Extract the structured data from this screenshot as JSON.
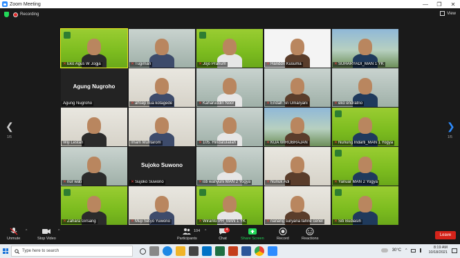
{
  "window": {
    "title": "Zoom Meeting",
    "controls": [
      "—",
      "❐",
      "✕"
    ]
  },
  "topbar": {
    "recording_label": "Recording",
    "view_label": "View"
  },
  "pager": {
    "left": "1/5",
    "right": "1/5"
  },
  "participants": [
    {
      "name": "Eko Agus W Jogja",
      "muted": true,
      "active": true
    },
    {
      "name": "Tugiman",
      "muted": true
    },
    {
      "name": "Jojo Prahum",
      "muted": true
    },
    {
      "name": "Handdri Kusuma",
      "muted": true
    },
    {
      "name": "SUHARYADI_MAN 1 YK",
      "muted": true
    },
    {
      "name": "Agung Nugroho",
      "muted": false,
      "big_name": "Agung Nugroho"
    },
    {
      "name": "ahsep kua kotagede",
      "muted": true
    },
    {
      "name": "Kaharuddin Noor",
      "muted": true
    },
    {
      "name": "Endah Sri Umaryani",
      "muted": true
    },
    {
      "name": "eko endratno",
      "muted": true
    },
    {
      "name": "Wiji Lestari",
      "muted": false
    },
    {
      "name": "Imam Muhtarom",
      "muted": false
    },
    {
      "name": "105. Hindatulailah",
      "muted": true
    },
    {
      "name": "KUA WIROBRAJAN",
      "muted": true
    },
    {
      "name": "Nunung Indarti_MAN 1 Yogya",
      "muted": true
    },
    {
      "name": "nur wati",
      "muted": true
    },
    {
      "name": "Sujoko Suwono",
      "muted": true,
      "big_name": "Sujoko Suwono"
    },
    {
      "name": "isti wahyuni MAN 2 Yogya",
      "muted": true
    },
    {
      "name": "Nunuk Adi",
      "muted": true
    },
    {
      "name": "Yanuar MAN 2 Yogya",
      "muted": true
    },
    {
      "name": "Zahara Girsang",
      "muted": true
    },
    {
      "name": "Muji Setyo Yuwono",
      "muted": true
    },
    {
      "name": "Wiranto PH_MAN 1 YK",
      "muted": true
    },
    {
      "name": "nanang suryana fahrie cenel",
      "muted": true
    },
    {
      "name": "Siti Budiasih",
      "muted": true
    }
  ],
  "toolbar": {
    "unmute": "Unmute",
    "stop_video": "Stop Video",
    "participants": "Participants",
    "participants_count": "104",
    "chat": "Chat",
    "chat_badge": "4",
    "share_screen": "Share Screen",
    "record": "Record",
    "reactions": "Reactions",
    "leave": "Leave"
  },
  "taskbar": {
    "search_placeholder": "Type here to search",
    "temperature": "30°C",
    "time": "8:19 AM",
    "date": "10/18/2021"
  },
  "colors": {
    "accent_green": "#23d959",
    "leave_red": "#d5231a",
    "active_speaker": "#f2f21f",
    "zoom_blue": "#2d8cff"
  }
}
